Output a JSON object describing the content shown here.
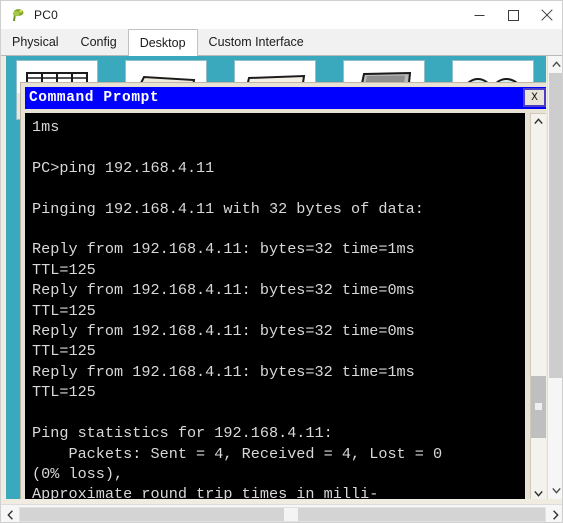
{
  "window": {
    "title": "PC0",
    "icon": "packet-tracer-icon",
    "controls": {
      "minimize": "minimize-icon",
      "maximize": "maximize-icon",
      "close": "close-icon"
    }
  },
  "tabs": [
    {
      "label": "Physical",
      "active": false
    },
    {
      "label": "Config",
      "active": false
    },
    {
      "label": "Desktop",
      "active": true
    },
    {
      "label": "Custom Interface",
      "active": false
    }
  ],
  "desktop": {
    "background_color": "#3aa9bd",
    "icons": [
      {
        "name": "ip-configuration-icon"
      },
      {
        "name": "dial-up-icon"
      },
      {
        "name": "terminal-icon"
      },
      {
        "name": "command-prompt-icon"
      },
      {
        "name": "web-browser-icon"
      }
    ]
  },
  "command_prompt": {
    "title": "Command Prompt",
    "title_bar_color": "#0000ff",
    "close_label": "X",
    "console_bg": "#000000",
    "console_fg": "#d8d8d8",
    "output": "1ms\n\nPC>ping 192.168.4.11\n\nPinging 192.168.4.11 with 32 bytes of data:\n\nReply from 192.168.4.11: bytes=32 time=1ms\nTTL=125\nReply from 192.168.4.11: bytes=32 time=0ms\nTTL=125\nReply from 192.168.4.11: bytes=32 time=0ms\nTTL=125\nReply from 192.168.4.11: bytes=32 time=1ms\nTTL=125\n\nPing statistics for 192.168.4.11:\n    Packets: Sent = 4, Received = 4, Lost = 0\n(0% loss),\nApproximate round trip times in milli-",
    "scrollbar": {
      "up_arrow": "chevron-up-icon",
      "down_arrow": "chevron-down-icon"
    }
  },
  "scrollbars": {
    "desktop_vertical": {
      "up_arrow": "chevron-up-icon",
      "down_arrow": "chevron-down-icon"
    },
    "window_horizontal": {
      "left_arrow": "chevron-left-icon",
      "right_arrow": "chevron-right-icon"
    }
  }
}
